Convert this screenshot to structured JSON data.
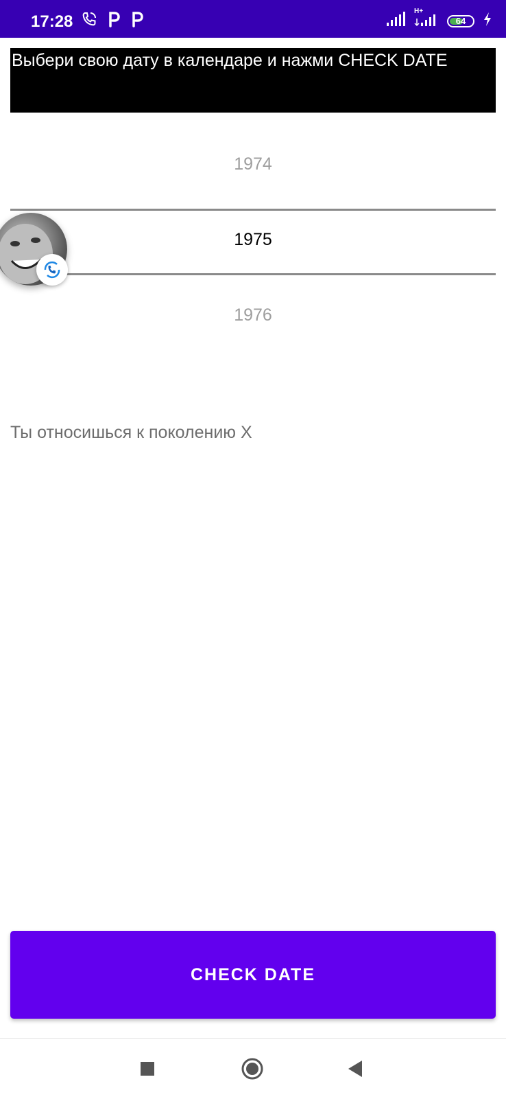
{
  "status_bar": {
    "time": "17:28",
    "battery_level": 64,
    "battery_text": "64",
    "network": "H+",
    "icons": [
      "phone-call-icon",
      "parking-p-icon",
      "parking-p-icon",
      "signal-icon",
      "signal-icon",
      "battery-icon",
      "charging-bolt-icon"
    ]
  },
  "instruction": {
    "text": "Выбери свою дату в календаре и нажми CHECK DATE"
  },
  "year_picker": {
    "previous": "1974",
    "selected": "1975",
    "next": "1976"
  },
  "floating_call": {
    "icon": "phone-sync-icon"
  },
  "result": {
    "text": "Ты относишься к поколению X"
  },
  "button": {
    "label": "CHECK DATE"
  },
  "colors": {
    "status_bar": "#3700b3",
    "primary": "#6200ee",
    "instruction_bg": "#000000"
  },
  "nav": {
    "icons": [
      "recents-square-icon",
      "home-circle-icon",
      "back-triangle-icon"
    ]
  }
}
